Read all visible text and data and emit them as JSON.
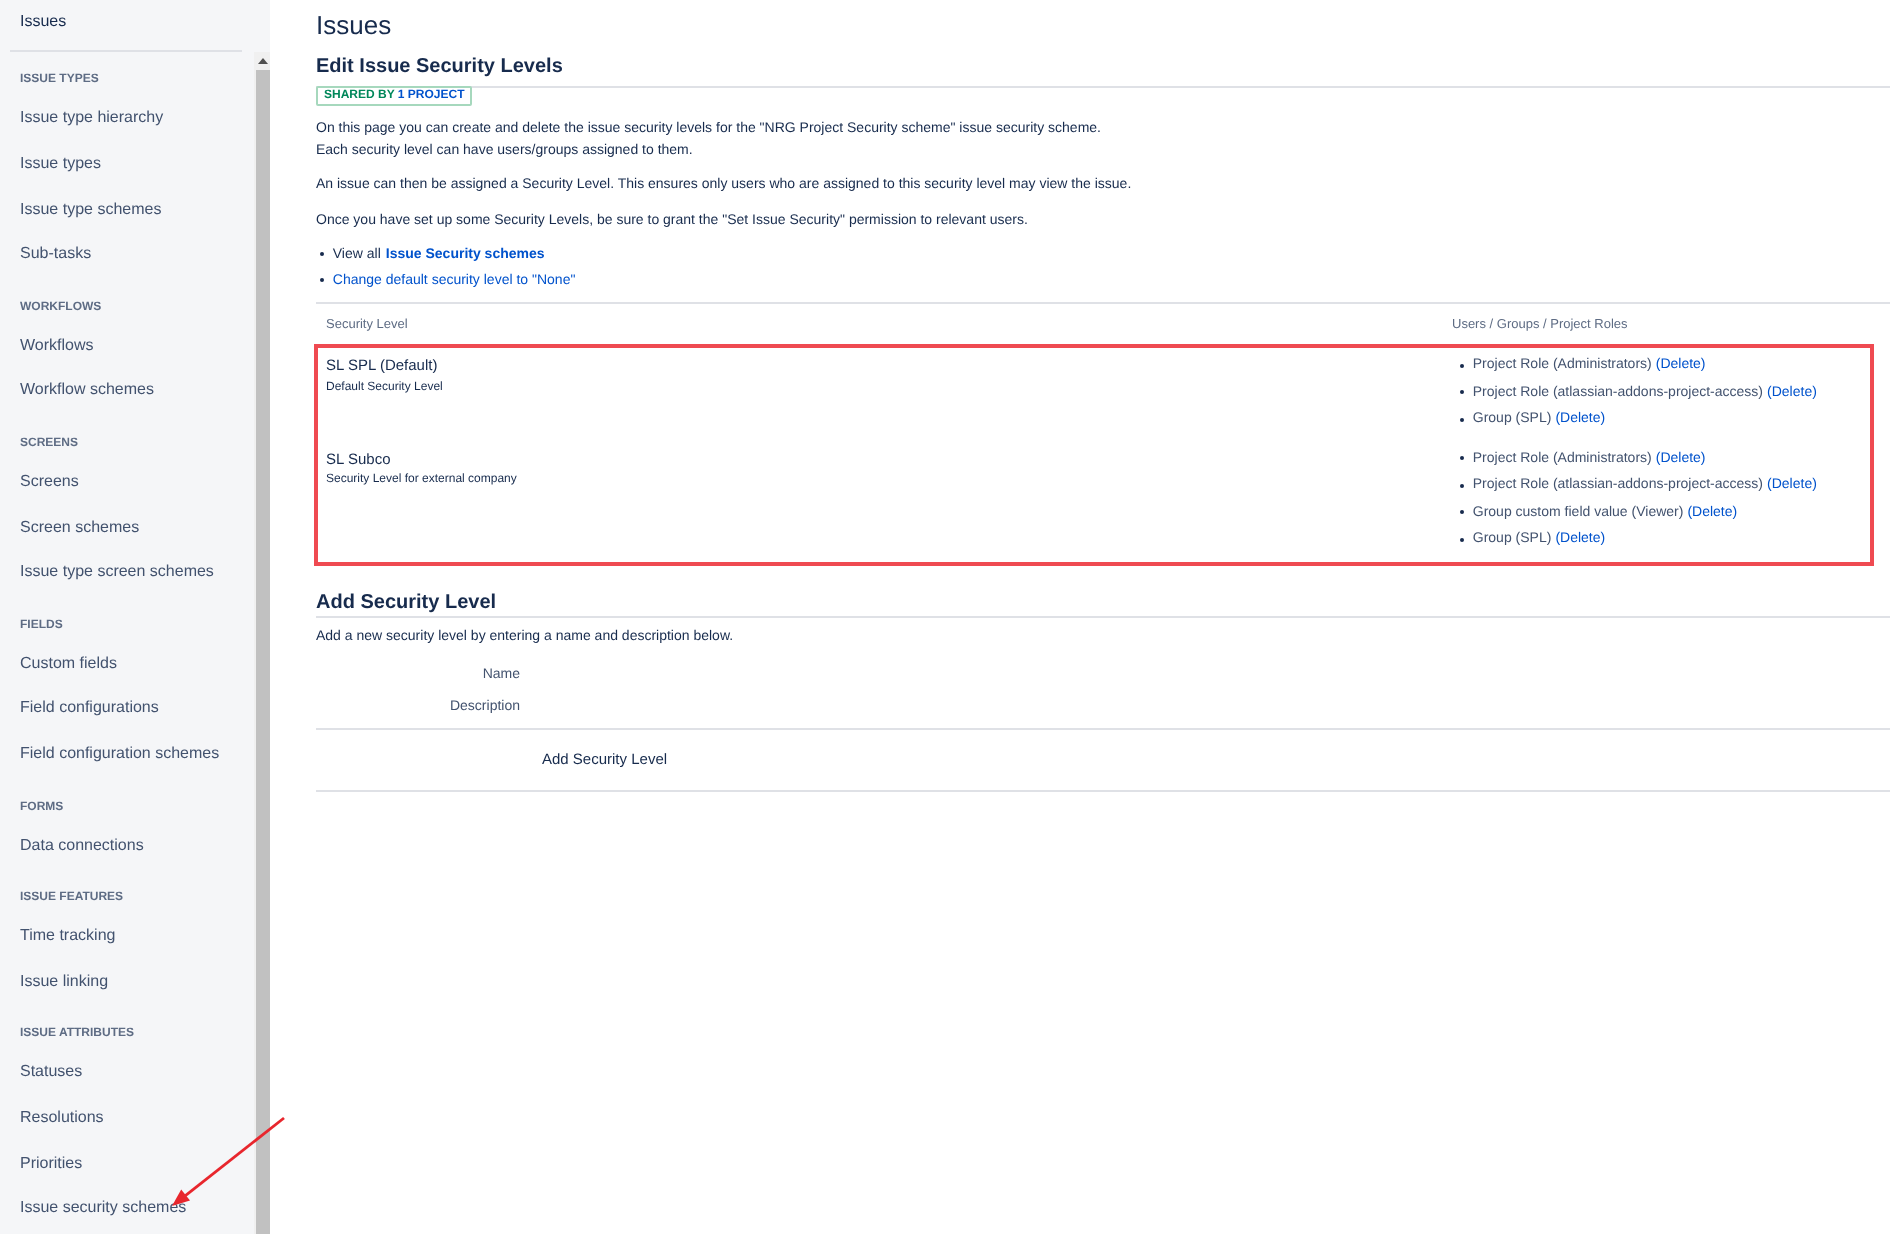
{
  "sidebar": {
    "title": "Issues",
    "sections": [
      {
        "heading": "ISSUE TYPES",
        "items": [
          {
            "label": "Issue type hierarchy",
            "annotated": false
          },
          {
            "label": "Issue types",
            "annotated": false
          },
          {
            "label": "Issue type schemes",
            "annotated": false
          },
          {
            "label": "Sub-tasks",
            "annotated": false
          }
        ]
      },
      {
        "heading": "WORKFLOWS",
        "items": [
          {
            "label": "Workflows",
            "annotated": false
          },
          {
            "label": "Workflow schemes",
            "annotated": false
          }
        ]
      },
      {
        "heading": "SCREENS",
        "items": [
          {
            "label": "Screens",
            "annotated": false
          },
          {
            "label": "Screen schemes",
            "annotated": false
          },
          {
            "label": "Issue type screen schemes",
            "annotated": false
          }
        ]
      },
      {
        "heading": "FIELDS",
        "items": [
          {
            "label": "Custom fields",
            "annotated": false
          },
          {
            "label": "Field configurations",
            "annotated": false
          },
          {
            "label": "Field configuration schemes",
            "annotated": false
          }
        ]
      },
      {
        "heading": "FORMS",
        "items": [
          {
            "label": "Data connections",
            "annotated": false
          }
        ]
      },
      {
        "heading": "ISSUE FEATURES",
        "items": [
          {
            "label": "Time tracking",
            "annotated": false
          },
          {
            "label": "Issue linking",
            "annotated": false
          }
        ]
      },
      {
        "heading": "ISSUE ATTRIBUTES",
        "items": [
          {
            "label": "Statuses",
            "annotated": false
          },
          {
            "label": "Resolutions",
            "annotated": false
          },
          {
            "label": "Priorities",
            "annotated": false
          },
          {
            "label": "Issue security schemes",
            "annotated": true
          }
        ]
      }
    ]
  },
  "page": {
    "title": "Issues"
  },
  "scheme": {
    "heading": "Edit Issue Security Levels",
    "badge": {
      "label": "SHARED BY",
      "link": "1 PROJECT"
    },
    "paragraphs": [
      "On this page you can create and delete the issue security levels for the \"NRG Project Security scheme\" issue security scheme.\nEach security level can have users/groups assigned to them.",
      "An issue can then be assigned a Security Level. This ensures only users who are assigned to this security level may view the issue.",
      "Once you have set up some Security Levels, be sure to grant the \"Set Issue Security\" permission to relevant users."
    ],
    "links": [
      {
        "text": "View all",
        "link": "Issue Security schemes"
      },
      {
        "link": "Change default security level to \"None\""
      }
    ]
  },
  "levels_table": {
    "columns": [
      "Security Level",
      "Users / Groups / Project Roles"
    ],
    "highlighted": true,
    "rows": [
      {
        "name": "SL SPL (Default)",
        "description": "Default Security Level",
        "members": [
          {
            "text": "Project Role (Administrators)",
            "action": "(Delete)"
          },
          {
            "text": "Project Role (atlassian-addons-project-access)",
            "action": "(Delete)"
          },
          {
            "text": "Group (SPL)",
            "action": "(Delete)"
          }
        ]
      },
      {
        "name": "SL Subco",
        "description": "Security Level for external company",
        "members": [
          {
            "text": "Project Role (Administrators)",
            "action": "(Delete)"
          },
          {
            "text": "Project Role (atlassian-addons-project-access)",
            "action": "(Delete)"
          },
          {
            "text": "Group custom field value (Viewer)",
            "action": "(Delete)"
          },
          {
            "text": "Group (SPL)",
            "action": "(Delete)"
          }
        ]
      }
    ]
  },
  "add_form": {
    "heading": "Add Security Level",
    "intro": "Add a new security level by entering a name and description below.",
    "fields": [
      {
        "label": "Name"
      },
      {
        "label": "Description"
      }
    ],
    "submit": "Add Security Level"
  }
}
